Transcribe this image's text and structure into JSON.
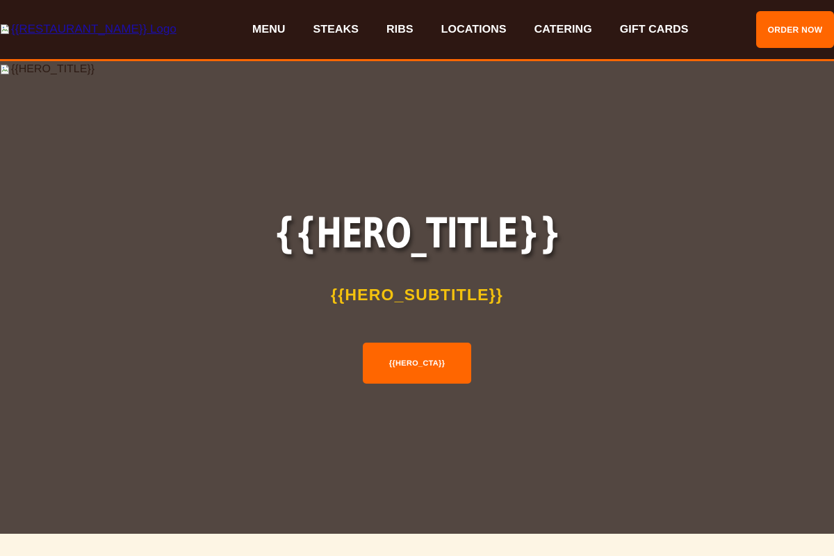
{
  "header": {
    "logo_alt": "{{RESTAURANT_NAME}} Logo",
    "nav": [
      {
        "label": "MENU"
      },
      {
        "label": "STEAKS"
      },
      {
        "label": "RIBS"
      },
      {
        "label": "LOCATIONS"
      },
      {
        "label": "CATERING"
      },
      {
        "label": "GIFT CARDS"
      }
    ],
    "order_button": "ORDER NOW"
  },
  "hero": {
    "image_alt": "{{HERO_TITLE}}",
    "title": "{{HERO_TITLE}}",
    "subtitle": "{{HERO_SUBTITLE}}",
    "cta": "{{HERO_CTA}}"
  },
  "colors": {
    "header_bg": "#2d1712",
    "accent": "#ff6600",
    "hero_bg": "#534741",
    "subtitle": "#f4c20d",
    "page_bg": "#fdf5e4"
  },
  "icons": {
    "logo_broken_image": "broken-image-icon",
    "hero_broken_image": "broken-image-icon"
  }
}
